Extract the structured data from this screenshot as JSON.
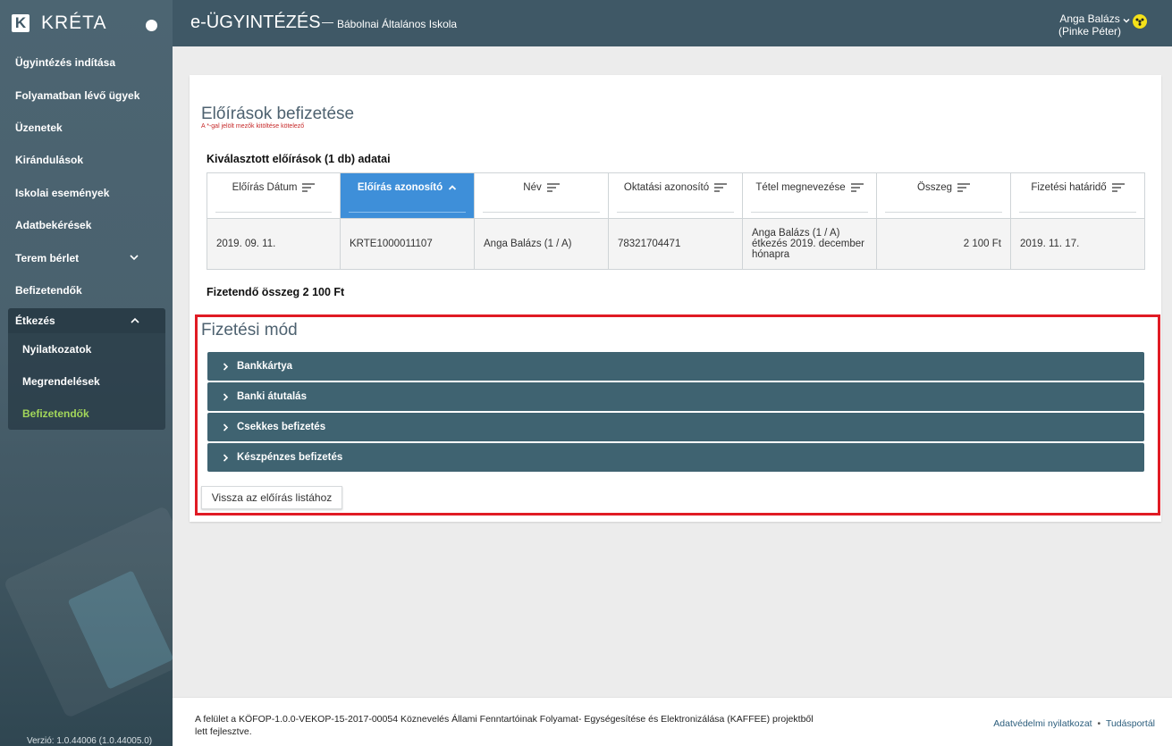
{
  "brand": {
    "logo_letter": "K",
    "name": "KRÉTA"
  },
  "sidebar": {
    "items": [
      {
        "label": "Ügyintézés indítása"
      },
      {
        "label": "Folyamatban lévő ügyek"
      },
      {
        "label": "Üzenetek"
      },
      {
        "label": "Kirándulások"
      },
      {
        "label": "Iskolai események"
      },
      {
        "label": "Adatbekérések"
      },
      {
        "label": "Terem bérlet"
      },
      {
        "label": "Befizetendők"
      }
    ],
    "expanded": {
      "label": "Étkezés",
      "items": [
        {
          "label": "Nyilatkozatok"
        },
        {
          "label": "Megrendelések"
        },
        {
          "label": "Befizetendők"
        }
      ]
    },
    "version": "Verzió: 1.0.44006 (1.0.44005.0)"
  },
  "header": {
    "app_title": "e-ÜGYINTÉZÉS",
    "dash": "—",
    "school": "Bábolnai Általános Iskola",
    "user_name": "Anga Balázs",
    "user_sub": "(Pinke Péter)"
  },
  "page": {
    "title": "Előírások befizetése",
    "required_note": "A *-gal jelölt mezők kitöltése kötelező",
    "selected_title": "Kiválasztott előírások (1 db) adatai",
    "total_label": "Fizetendő összeg",
    "total_value": "2 100 Ft"
  },
  "table": {
    "columns": [
      {
        "label": "Előírás Dátum"
      },
      {
        "label": "Előírás azonosító"
      },
      {
        "label": "Név"
      },
      {
        "label": "Oktatási azonosító"
      },
      {
        "label": "Tétel megnevezése"
      },
      {
        "label": "Összeg"
      },
      {
        "label": "Fizetési határidő"
      }
    ],
    "rows": [
      {
        "date": "2019. 09. 11.",
        "id": "KRTE1000011107",
        "name": "Anga Balázs (1 / A)",
        "edu_id": "78321704471",
        "item": "Anga Balázs (1 / A) étkezés 2019. december hónapra",
        "amount": "2 100 Ft",
        "deadline": "2019. 11. 17."
      }
    ]
  },
  "payment": {
    "title": "Fizetési mód",
    "methods": [
      {
        "label": "Bankkártya"
      },
      {
        "label": "Banki átutalás"
      },
      {
        "label": "Csekkes befizetés"
      },
      {
        "label": "Készpénzes befizetés"
      }
    ],
    "back_label": "Vissza az előírás listához"
  },
  "footer": {
    "text": "A felület a KÖFOP-1.0.0-VEKOP-15-2017-00054 Köznevelés Állami Fenntartóinak Folyamat- Egységesítése és Elektronizálása (KAFFEE) projektből lett fejlesztve.",
    "privacy": "Adatvédelmi nyilatkozat",
    "sep": "•",
    "knowledge": "Tudásportál"
  },
  "colors": {
    "header": "#3f5866",
    "sorted_column": "#3e8fd9",
    "accordion": "#3f6371",
    "highlight_border": "#e01b24",
    "active_nav": "#a2d65a"
  }
}
